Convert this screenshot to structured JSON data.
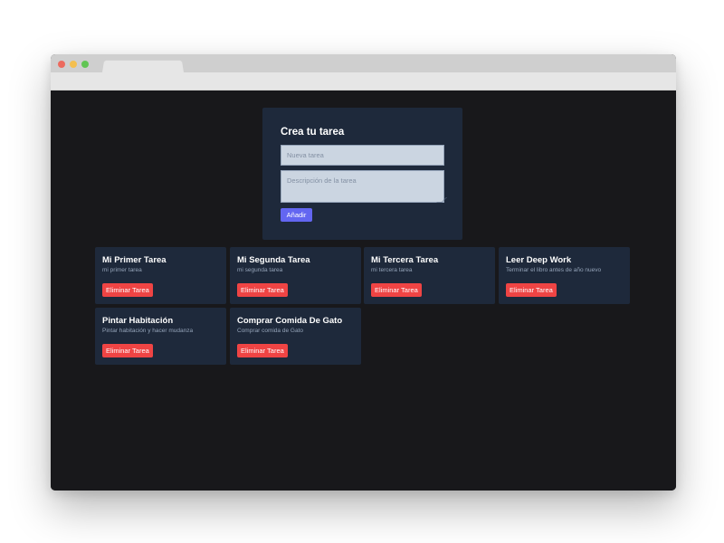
{
  "form": {
    "heading": "Crea tu tarea",
    "title_placeholder": "Nueva tarea",
    "title_value": "",
    "description_placeholder": "Descripción de la tarea",
    "description_value": "",
    "add_label": "Añadir"
  },
  "tasks": [
    {
      "title": "Mi Primer Tarea",
      "description": "mi primer tarea",
      "delete_label": "Eliminar Tarea"
    },
    {
      "title": "Mi Segunda Tarea",
      "description": "mi segunda tarea",
      "delete_label": "Eliminar Tarea"
    },
    {
      "title": "Mi Tercera Tarea",
      "description": "mi tercera tarea",
      "delete_label": "Eliminar Tarea"
    },
    {
      "title": "Leer Deep Work",
      "description": "Terminar el libro antes de año nuevo",
      "delete_label": "Eliminar Tarea"
    },
    {
      "title": "Pintar Habitación",
      "description": "Pintar habitación y hacer mudanza",
      "delete_label": "Eliminar Tarea"
    },
    {
      "title": "Comprar Comida De Gato",
      "description": "Comprar comida de Gato",
      "delete_label": "Eliminar Tarea"
    }
  ],
  "colors": {
    "page_background": "#18181b",
    "card_background": "#1e293b",
    "input_background": "#cbd5e1",
    "add_button": "#6366f1",
    "delete_button": "#ef4444"
  }
}
